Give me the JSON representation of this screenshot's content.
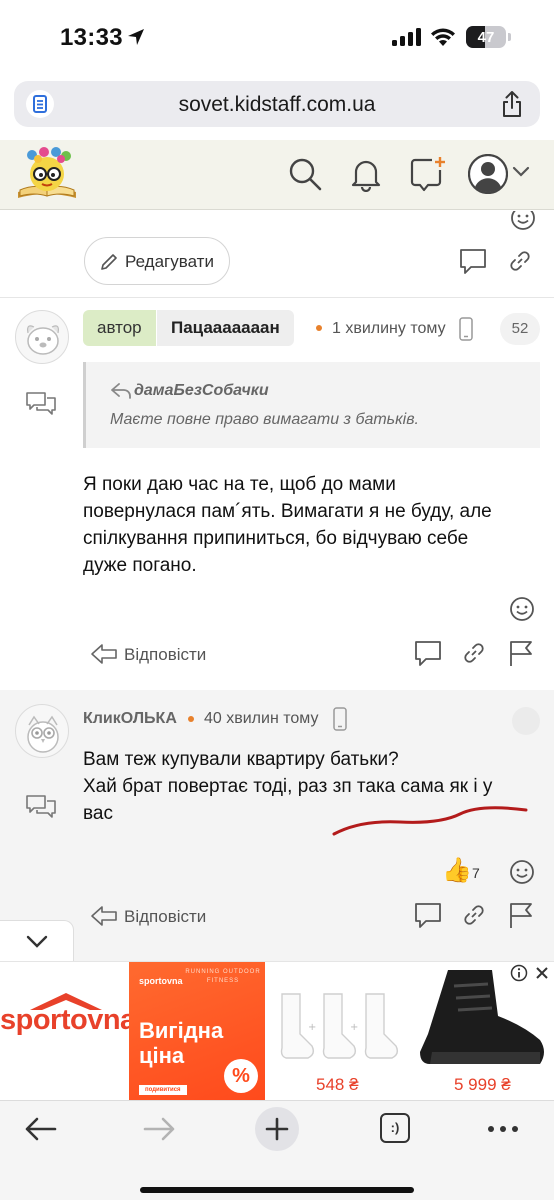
{
  "status_bar": {
    "time": "13:33",
    "battery": "47"
  },
  "browser": {
    "url": "sovet.kidstaff.com.ua"
  },
  "header": {
    "icons": [
      "logo-icon",
      "search-icon",
      "bell-icon",
      "new-message-icon",
      "user-avatar-icon",
      "chevron-down-icon"
    ]
  },
  "own_post": {
    "edit_label": "Редагувати"
  },
  "comment1": {
    "badge": "автор",
    "author": "Пацааааааан",
    "time": "1 хвилину тому",
    "count": "52",
    "quote": {
      "author": "дамаБезСобачки",
      "text": "Маєте повне право вимагати з батьків."
    },
    "text_lines": [
      "Я поки даю час на те, щоб до мами",
      "повернулася пам´ять. Вимагати я не буду, але",
      "спілкування припиниться, бо відчуваю себе",
      "дуже погано."
    ],
    "reply_label": "Відповісти"
  },
  "comment2": {
    "author": "КликОЛЬКА",
    "time": "40 хвилин тому",
    "text_lines": [
      "Вам теж купували квартиру батьки?",
      "Хай брат повертає тоді, раз зп така сама як і у",
      "вас"
    ],
    "reaction_count": "7",
    "reply_label": "Відповісти"
  },
  "ad": {
    "brand": "sportovna",
    "promo_brand": "sportovna",
    "promo_tag": "RUNNING OUTDOOR FITNESS",
    "headline": "Вигідна ціна",
    "cta": "подивитися",
    "percent": "%",
    "price1": "548 ₴",
    "price2": "5 999 ₴",
    "colors": {
      "brand_red": "#e8412a",
      "promo_orange": "#ff4a1c"
    }
  },
  "toolbar": {
    "icons": [
      "back-icon",
      "forward-icon",
      "new-tab-icon",
      "tabs-icon",
      "more-icon"
    ],
    "tabs_label": ":)"
  }
}
